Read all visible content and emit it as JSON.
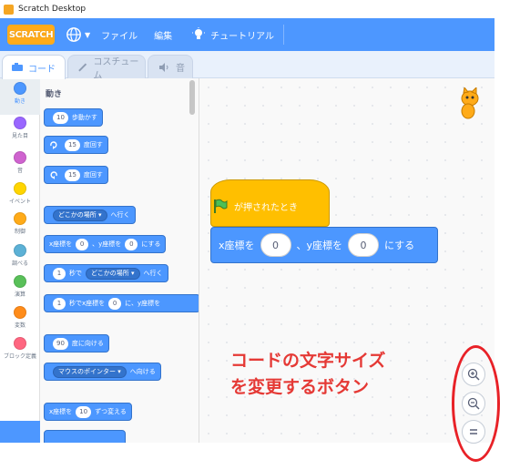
{
  "window": {
    "title": "Scratch Desktop"
  },
  "menu": {
    "logo_text": "SCRATCH",
    "language_icon": "globe-icon",
    "file_label": "ファイル",
    "edit_label": "編集",
    "tutorial_label": "チュートリアル",
    "tutorial_icon": "lightbulb-icon"
  },
  "tabs": [
    {
      "label": "コード",
      "icon": "code-icon"
    },
    {
      "label": "コスチューム",
      "icon": "brush-icon"
    },
    {
      "label": "音",
      "icon": "speaker-icon"
    }
  ],
  "categories": [
    {
      "label": "動き",
      "color": "#4c97ff"
    },
    {
      "label": "見た目",
      "color": "#9966ff"
    },
    {
      "label": "音",
      "color": "#cf63cf"
    },
    {
      "label": "イベント",
      "color": "#ffd500"
    },
    {
      "label": "制御",
      "color": "#ffab19"
    },
    {
      "label": "調べる",
      "color": "#5cb1d6"
    },
    {
      "label": "演算",
      "color": "#59c059"
    },
    {
      "label": "変数",
      "color": "#ff8c1a"
    },
    {
      "label": "ブロック定義",
      "color": "#ff6680"
    }
  ],
  "palette": {
    "heading": "動き",
    "blocks": {
      "move_value": "10",
      "move_text": "歩動かす",
      "turn_right_value": "15",
      "turn_right_text": "度回す",
      "turn_left_value": "15",
      "turn_left_text": "度回す",
      "goto_menu": "どこかの場所",
      "goto_text": "へ行く",
      "gotoxy_x_label": "x座標を",
      "gotoxy_x": "0",
      "gotoxy_y_label": "、y座標を",
      "gotoxy_y": "0",
      "gotoxy_suffix": "にする",
      "glide_secs": "1",
      "glide_mid": "秒で",
      "glide_menu": "どこかの場所",
      "glide_suffix": "へ行く",
      "glidexy_secs": "1",
      "glidexy_mid": "秒でx座標を",
      "glidexy_x": "0",
      "glidexy_mid2": "に、y座標を",
      "point_value": "90",
      "point_text": "度に向ける",
      "towards_menu": "マウスのポインター",
      "towards_text": "へ向ける",
      "changex_label": "x座標を",
      "changex_value": "10",
      "changex_text": "ずつ変える"
    }
  },
  "script": {
    "hat_text": "が押されたとき",
    "goto_x_label": "x座標を",
    "goto_x": "0",
    "goto_y_label": "、y座標を",
    "goto_y": "0",
    "goto_suffix": "にする"
  },
  "zoom": {
    "in_icon": "zoom-in-icon",
    "out_icon": "zoom-out-icon",
    "reset_icon": "zoom-reset-icon"
  },
  "annotation": {
    "line1": "コードの文字サイズ",
    "line2": "を変更するボタン",
    "color": "#e53935"
  }
}
